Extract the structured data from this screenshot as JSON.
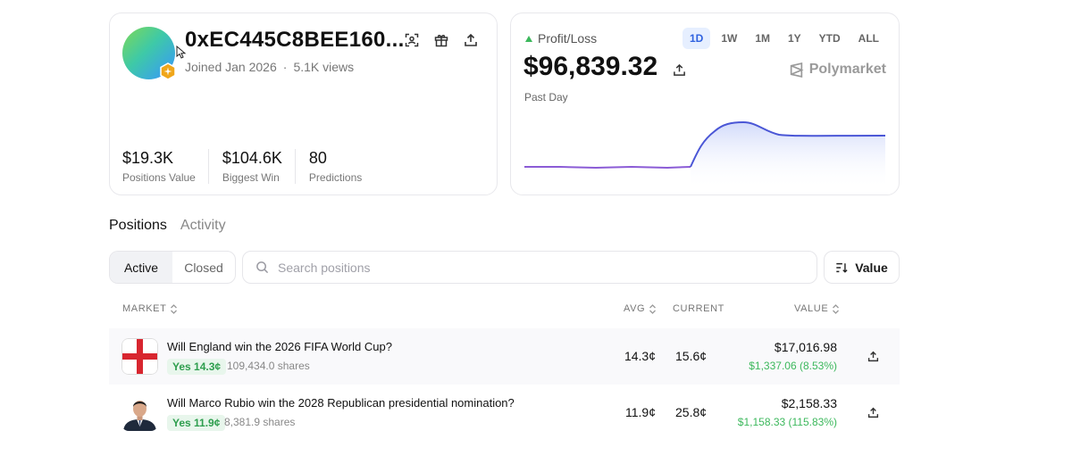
{
  "profile": {
    "handle": "0xEC445C8BEE160...",
    "joined": "Joined Jan 2026",
    "separator": "·",
    "views": "5.1K views",
    "stats": [
      {
        "value": "$19.3K",
        "label": "Positions Value"
      },
      {
        "value": "$104.6K",
        "label": "Biggest Win"
      },
      {
        "value": "80",
        "label": "Predictions"
      }
    ]
  },
  "pnl": {
    "label": "Profit/Loss",
    "ranges": [
      "1D",
      "1W",
      "1M",
      "1Y",
      "YTD",
      "ALL"
    ],
    "active_range": "1D",
    "value": "$96,839.32",
    "period": "Past Day",
    "brand": "Polymarket",
    "colors": {
      "line_before": "#8b5cd6",
      "line_after": "#4a56d6",
      "fill": "#dbe2fb",
      "positive": "#3cb85c"
    }
  },
  "tabs": {
    "positions": "Positions",
    "activity": "Activity",
    "active": "Positions"
  },
  "filters": {
    "active": "Active",
    "closed": "Closed",
    "search_placeholder": "Search positions",
    "sort_label": "Value"
  },
  "table": {
    "headers": {
      "market": "MARKET",
      "avg": "AVG",
      "current": "CURRENT",
      "value": "VALUE"
    },
    "rows": [
      {
        "title": "Will England win the 2026 FIFA World Cup?",
        "outcome": "Yes 14.3¢",
        "shares": "109,434.0 shares",
        "avg": "14.3¢",
        "current": "15.6¢",
        "value": "$17,016.98",
        "change": "$1,337.06 (8.53%)",
        "thumb": "england-flag"
      },
      {
        "title": "Will Marco Rubio win the 2028 Republican presidential nomination?",
        "outcome": "Yes 11.9¢",
        "shares": "8,381.9 shares",
        "avg": "11.9¢",
        "current": "25.8¢",
        "value": "$2,158.33",
        "change": "$1,158.33 (115.83%)",
        "thumb": "person-portrait"
      }
    ]
  }
}
